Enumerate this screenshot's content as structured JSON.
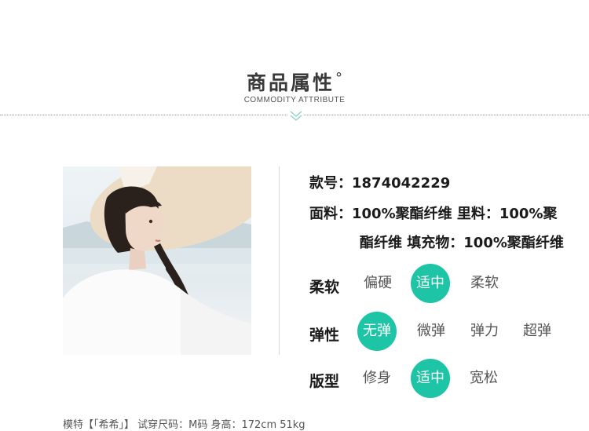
{
  "header": {
    "title": "商品属性",
    "title_mark": "°",
    "subtitle": "COMMODITY ATTRIBUTE"
  },
  "icons": {
    "divider": "chevron-down-icon"
  },
  "colors": {
    "accent": "#1dc4a5",
    "text": "#1a1a1a",
    "muted": "#555555"
  },
  "product": {
    "style_no": "款号：1874042229",
    "fabric_line1": "面料：100%聚酯纤维 里料：100%聚",
    "fabric_line2": "酯纤维 填充物：100%聚酯纤维"
  },
  "attributes": {
    "softness": {
      "label": "柔软",
      "options": [
        "偏硬",
        "适中",
        "柔软"
      ],
      "selected": "适中"
    },
    "elasticity": {
      "label": "弹性",
      "options": [
        "无弹",
        "微弹",
        "弹力",
        "超弹"
      ],
      "selected": "无弹"
    },
    "fit": {
      "label": "版型",
      "options": [
        "修身",
        "适中",
        "宽松"
      ],
      "selected": "适中"
    }
  },
  "footer": {
    "model_info": "模特【「希希」】 试穿尺码：M码 身高：172cm 51kg"
  }
}
